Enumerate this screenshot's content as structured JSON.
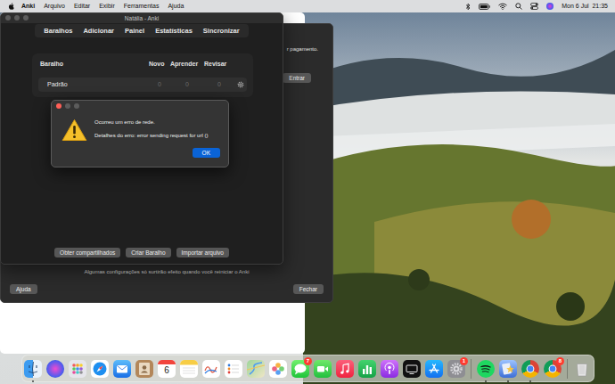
{
  "menu_bar": {
    "app": "Anki",
    "items": [
      "Arquivo",
      "Editar",
      "Exibir",
      "Ferramentas",
      "Ajuda"
    ],
    "clock": "Mon 6 Jul  21:35"
  },
  "preferences_window": {
    "partial_text": "r pagamento.",
    "login_button": "Entrar",
    "note": "Algumas configurações só surtirão efeito quando você reiniciar o Anki",
    "buttons": [
      "Ajuda",
      "Fechar"
    ]
  },
  "main_window": {
    "title": "Natália - Anki",
    "toolbar": [
      "Baralhos",
      "Adicionar",
      "Painel",
      "Estatísticas",
      "Sincronizar"
    ],
    "table": {
      "columns": [
        "Baralho",
        "Novo",
        "Aprender",
        "Revisar"
      ],
      "rows": [
        [
          "Padrão",
          "0",
          "0",
          "0"
        ]
      ]
    },
    "buttons": [
      "Obter compartilhados",
      "Criar Baralho",
      "Importar arquivo"
    ]
  },
  "dialog": {
    "message": "Ocorreu um erro de rede.",
    "details": "Detalhes do erro: error sending request for url ()",
    "button": "OK"
  },
  "dock": {
    "items": [
      {
        "kind": "finder",
        "running": true
      },
      {
        "kind": "siri",
        "running": false
      },
      {
        "kind": "launchpad",
        "running": false
      },
      {
        "kind": "safari",
        "running": false
      },
      {
        "kind": "mail",
        "running": false
      },
      {
        "kind": "contacts",
        "running": false
      },
      {
        "kind": "calendar",
        "running": false,
        "date": "6"
      },
      {
        "kind": "notes",
        "running": false
      },
      {
        "kind": "grapher",
        "running": false
      },
      {
        "kind": "reminders",
        "running": false
      },
      {
        "kind": "maps",
        "running": false
      },
      {
        "kind": "photos",
        "running": false
      },
      {
        "kind": "messages",
        "running": false,
        "badge": "7"
      },
      {
        "kind": "facetime",
        "running": false
      },
      {
        "kind": "music",
        "running": false
      },
      {
        "kind": "numbers",
        "running": false
      },
      {
        "kind": "podcasts",
        "running": false
      },
      {
        "kind": "tv",
        "running": false
      },
      {
        "kind": "appstore",
        "running": false
      },
      {
        "kind": "settings",
        "running": false,
        "badge": "1"
      },
      {
        "kind": "separator"
      },
      {
        "kind": "spotify",
        "running": true
      },
      {
        "kind": "anki",
        "running": true
      },
      {
        "kind": "chrome",
        "running": true
      },
      {
        "kind": "chrome",
        "running": false,
        "badge": "8"
      },
      {
        "kind": "separator"
      },
      {
        "kind": "trash",
        "running": false
      }
    ]
  }
}
